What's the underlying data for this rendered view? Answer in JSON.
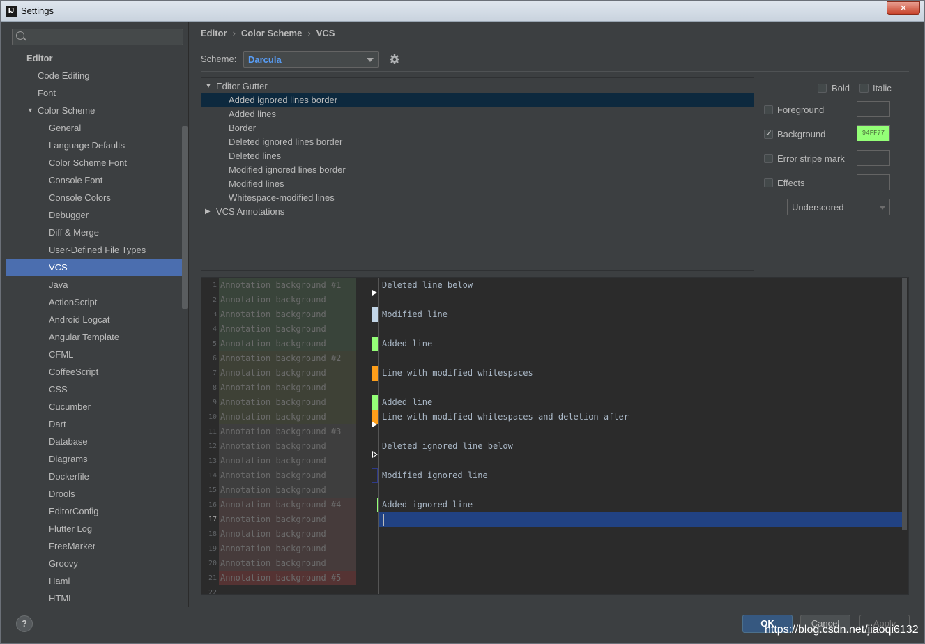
{
  "window": {
    "title": "Settings",
    "app_icon": "IJ",
    "close_label": "✕"
  },
  "sidebar": {
    "search_placeholder": "",
    "items": [
      {
        "label": "Editor",
        "level": 0
      },
      {
        "label": "Code Editing",
        "level": 1
      },
      {
        "label": "Font",
        "level": 1
      },
      {
        "label": "Color Scheme",
        "level": 1,
        "expanded": true
      },
      {
        "label": "General",
        "level": 2
      },
      {
        "label": "Language Defaults",
        "level": 2
      },
      {
        "label": "Color Scheme Font",
        "level": 2
      },
      {
        "label": "Console Font",
        "level": 2
      },
      {
        "label": "Console Colors",
        "level": 2
      },
      {
        "label": "Debugger",
        "level": 2
      },
      {
        "label": "Diff & Merge",
        "level": 2
      },
      {
        "label": "User-Defined File Types",
        "level": 2
      },
      {
        "label": "VCS",
        "level": 2,
        "selected": true
      },
      {
        "label": "Java",
        "level": 2
      },
      {
        "label": "ActionScript",
        "level": 2
      },
      {
        "label": "Android Logcat",
        "level": 2
      },
      {
        "label": "Angular Template",
        "level": 2
      },
      {
        "label": "CFML",
        "level": 2
      },
      {
        "label": "CoffeeScript",
        "level": 2
      },
      {
        "label": "CSS",
        "level": 2
      },
      {
        "label": "Cucumber",
        "level": 2
      },
      {
        "label": "Dart",
        "level": 2
      },
      {
        "label": "Database",
        "level": 2
      },
      {
        "label": "Diagrams",
        "level": 2
      },
      {
        "label": "Dockerfile",
        "level": 2
      },
      {
        "label": "Drools",
        "level": 2
      },
      {
        "label": "EditorConfig",
        "level": 2
      },
      {
        "label": "Flutter Log",
        "level": 2
      },
      {
        "label": "FreeMarker",
        "level": 2
      },
      {
        "label": "Groovy",
        "level": 2
      },
      {
        "label": "Haml",
        "level": 2
      },
      {
        "label": "HTML",
        "level": 2
      }
    ],
    "help_label": "?"
  },
  "breadcrumb": [
    "Editor",
    "Color Scheme",
    "VCS"
  ],
  "breadcrumb_sep": "›",
  "scheme": {
    "label": "Scheme:",
    "value": "Darcula"
  },
  "attributes": {
    "groups": [
      {
        "label": "Editor Gutter",
        "expanded": true,
        "children": [
          "Added ignored lines border",
          "Added lines",
          "Border",
          "Deleted ignored lines border",
          "Deleted lines",
          "Modified ignored lines border",
          "Modified lines",
          "Whitespace-modified lines"
        ]
      },
      {
        "label": "VCS Annotations",
        "expanded": false,
        "children": []
      }
    ],
    "selected": "Added ignored lines border"
  },
  "options": {
    "bold": "Bold",
    "italic": "Italic",
    "foreground": "Foreground",
    "background": "Background",
    "background_checked": true,
    "background_value": "94FF77",
    "error_stripe": "Error stripe mark",
    "effects": "Effects",
    "effects_type": "Underscored"
  },
  "preview": {
    "annotations": [
      "Annotation background #1",
      "Annotation background",
      "Annotation background",
      "Annotation background",
      "Annotation background",
      "Annotation background #2",
      "Annotation background",
      "Annotation background",
      "Annotation background",
      "Annotation background",
      "Annotation background #3",
      "Annotation background",
      "Annotation background",
      "Annotation background",
      "Annotation background",
      "Annotation background #4",
      "Annotation background",
      "Annotation background",
      "Annotation background",
      "Annotation background",
      "Annotation background #5"
    ],
    "line_numbers": [
      "1",
      "2",
      "3",
      "4",
      "5",
      "6",
      "7",
      "8",
      "9",
      "10",
      "11",
      "12",
      "13",
      "14",
      "15",
      "16",
      "17",
      "18",
      "19",
      "20",
      "21",
      "22"
    ],
    "current_line": 17,
    "code_lines": [
      {
        "line": 1,
        "text": "Deleted line below"
      },
      {
        "line": 3,
        "text": "Modified line"
      },
      {
        "line": 5,
        "text": "Added line"
      },
      {
        "line": 7,
        "text": "Line with modified whitespaces"
      },
      {
        "line": 9,
        "text": "Added line"
      },
      {
        "line": 10,
        "text": "Line with modified whitespaces and deletion after"
      },
      {
        "line": 12,
        "text": "Deleted ignored line below"
      },
      {
        "line": 14,
        "text": "Modified ignored line"
      },
      {
        "line": 16,
        "text": "Added ignored line"
      }
    ],
    "colors": {
      "modified": "#c3d6e8",
      "added": "#94ff77",
      "whitespace": "#ff9f1a",
      "annotation_1": "#39443a",
      "annotation_2": "#3e4136",
      "annotation_3": "#3e3e3e",
      "annotation_4": "#463b3b",
      "annotation_5": "#553333"
    }
  },
  "buttons": {
    "ok": "OK",
    "cancel": "Cancel",
    "apply": "Apply"
  },
  "watermark": "https://blog.csdn.net/jiaoqi6132"
}
